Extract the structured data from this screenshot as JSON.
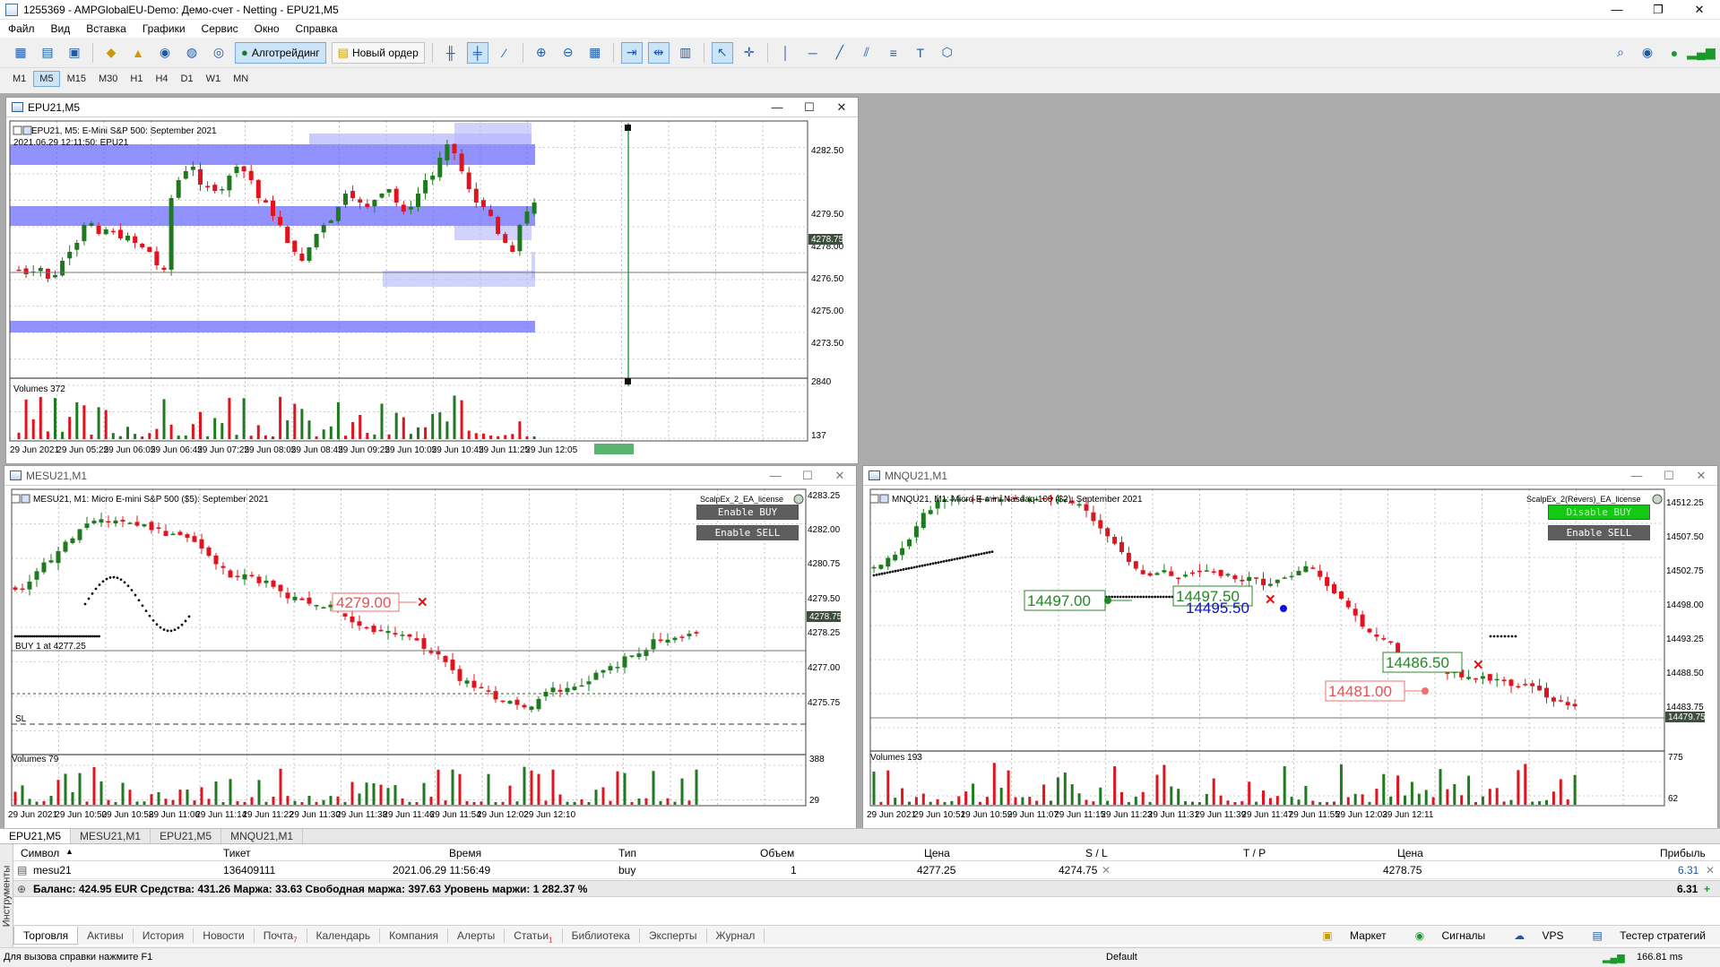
{
  "window": {
    "title": "1255369 - AMPGlobalEU-Demo: Демо-счет - Netting - EPU21,M5",
    "buttons": [
      "—",
      "❐",
      "✕"
    ]
  },
  "menu": [
    "Файл",
    "Вид",
    "Вставка",
    "Графики",
    "Сервис",
    "Окно",
    "Справка"
  ],
  "toolbar": {
    "algo_label": "Алготрейдинг",
    "new_order_label": "Новый ордер"
  },
  "timeframes": [
    "M1",
    "M5",
    "M15",
    "M30",
    "H1",
    "H4",
    "D1",
    "W1",
    "MN"
  ],
  "active_timeframe": "M5",
  "charts": {
    "epu": {
      "window_title": "EPU21,M5",
      "info_line": "EPU21, M5: E-Mini S&P 500: September 2021",
      "crosshair_line": "2021.06.29 12:11:50: EPU21",
      "price_labels": [
        "4282.50",
        "4279.50",
        "4278.00",
        "4276.50",
        "4275.00",
        "4273.50"
      ],
      "current_price": "4278.75",
      "volume_label": "Volumes 372",
      "volume_scale": [
        "2840",
        "137"
      ],
      "time_labels": [
        "29 Jun 2021",
        "29 Jun 05:25",
        "29 Jun 06:05",
        "29 Jun 06:45",
        "29 Jun 07:25",
        "29 Jun 08:05",
        "29 Jun 08:45",
        "29 Jun 09:25",
        "29 Jun 10:05",
        "29 Jun 10:45",
        "29 Jun 11:25",
        "29 Jun 12:05"
      ]
    },
    "mesu": {
      "window_title": "MESU21,M1",
      "info_line": "MESU21, M1: Micro E-mini S&P 500 ($5): September 2021",
      "ea_label": "ScalpEx_2_EA_license",
      "btn_buy": "Enable BUY",
      "btn_sell": "Enable SELL",
      "price_labels": [
        "4283.25",
        "4282.00",
        "4280.75",
        "4279.50",
        "4278.25",
        "4277.00",
        "4275.75"
      ],
      "current_price": "4278.75",
      "order_label": "BUY 1 at 4277.25",
      "sl_label": "SL",
      "level_box": "4279.00",
      "volume_label": "Volumes 79",
      "volume_scale": [
        "388",
        "29"
      ],
      "time_labels": [
        "29 Jun 2021",
        "29 Jun 10:50",
        "29 Jun 10:58",
        "29 Jun 11:06",
        "29 Jun 11:14",
        "29 Jun 11:22",
        "29 Jun 11:30",
        "29 Jun 11:38",
        "29 Jun 11:46",
        "29 Jun 11:54",
        "29 Jun 12:02",
        "29 Jun 12:10"
      ]
    },
    "mnqu": {
      "window_title": "MNQU21,M1",
      "info_line": "MNQU21, M1: Micro E-mini Nasdaq-100 ($2): September 2021",
      "ea_label": "ScalpEx_2(Revers)_EA_license",
      "btn_buy": "Disable BUY",
      "btn_sell": "Enable SELL",
      "price_labels": [
        "14512.25",
        "14507.50",
        "14502.75",
        "14498.00",
        "14493.25",
        "14488.50",
        "14483.75"
      ],
      "current_price": "14479.75",
      "level_boxes": [
        "14497.00",
        "14497.50",
        "14495.50",
        "14486.50",
        "14481.00"
      ],
      "volume_label": "Volumes 193",
      "volume_scale": [
        "775",
        "62"
      ],
      "time_labels": [
        "29 Jun 2021",
        "29 Jun 10:51",
        "29 Jun 10:59",
        "29 Jun 11:07",
        "29 Jun 11:15",
        "29 Jun 11:23",
        "29 Jun 11:31",
        "29 Jun 11:39",
        "29 Jun 11:47",
        "29 Jun 11:55",
        "29 Jun 12:03",
        "29 Jun 12:11"
      ]
    }
  },
  "chart_tabs": [
    "EPU21,M5",
    "MESU21,M1",
    "EPU21,M5",
    "MNQU21,M1"
  ],
  "terminal": {
    "side_label": "Инструменты",
    "columns": [
      "Символ",
      "Тикет",
      "Время",
      "Тип",
      "Объем",
      "Цена",
      "S / L",
      "T / P",
      "Цена",
      "Прибыль"
    ],
    "row": {
      "symbol": "mesu21",
      "ticket": "136409111",
      "time": "2021.06.29 11:56:49",
      "type": "buy",
      "volume": "1",
      "price": "4277.25",
      "sl": "4274.75",
      "tp": "",
      "current": "4278.75",
      "profit": "6.31"
    },
    "balance_line": "Баланс: 424.95 EUR  Средства: 431.26  Маржа: 33.63  Свободная маржа: 397.63  Уровень маржи: 1 282.37 %",
    "total_profit": "6.31",
    "tabs": [
      "Торговля",
      "Активы",
      "История",
      "Новости",
      "Почта",
      "Календарь",
      "Компания",
      "Алерты",
      "Статьи",
      "Библиотека",
      "Эксперты",
      "Журнал"
    ],
    "mail_badge": "7",
    "articles_badge": "1",
    "right_tabs": [
      "Маркет",
      "Сигналы",
      "VPS",
      "Тестер стратегий"
    ]
  },
  "status": {
    "help": "Для вызова справки нажмите F1",
    "profile": "Default",
    "ping": "166.81 ms"
  },
  "colors": {
    "bull": "#1f7a1f",
    "bear": "#e0141e",
    "zone": "#6464ff",
    "zone_light": "#b4b4ff",
    "mdi_bg": "#ababab",
    "accent": "#1c5aa8"
  }
}
